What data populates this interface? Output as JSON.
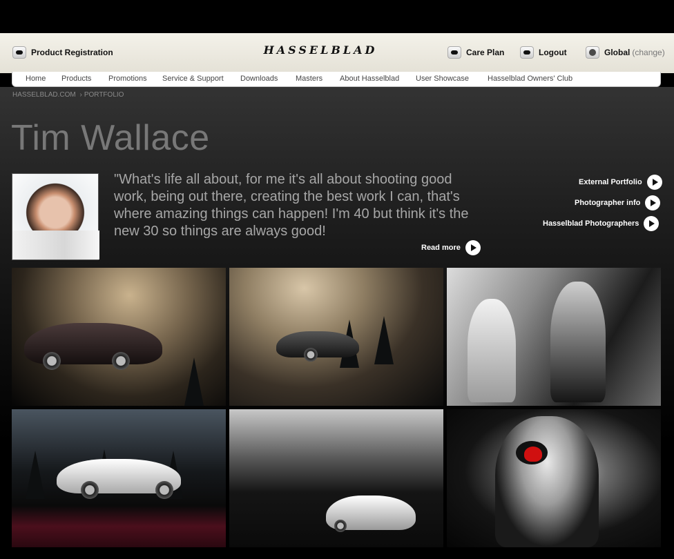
{
  "header": {
    "product_registration": "Product Registration",
    "brand": "HASSELBLAD",
    "care_plan": "Care Plan",
    "logout": "Logout",
    "region": "Global",
    "region_change": "(change)"
  },
  "nav": {
    "items": [
      "Home",
      "Products",
      "Promotions",
      "Service & Support",
      "Downloads",
      "Masters",
      "About Hasselblad",
      "User Showcase",
      "Hasselblad Owners' Club"
    ]
  },
  "breadcrumb": {
    "root": "HASSELBLAD.COM",
    "separator": "›",
    "current": "PORTFOLIO"
  },
  "profile": {
    "name": "Tim Wallace",
    "quote": "\"What's life all about, for me it's all about shooting good work, being out there, creating the best work I can, that's where amazing things can happen! I'm 40 but think it's the new 30 so things are always good!",
    "read_more": "Read more"
  },
  "side_links": {
    "external_portfolio": "External Portfolio",
    "photographer_info": "Photographer info",
    "hasselblad_photographers": "Hasselblad Photographers"
  },
  "colors": {
    "header_bg": "#ece9df",
    "page_bg": "#000000",
    "name_text": "#787878",
    "quote_text": "#a7a7a7"
  }
}
